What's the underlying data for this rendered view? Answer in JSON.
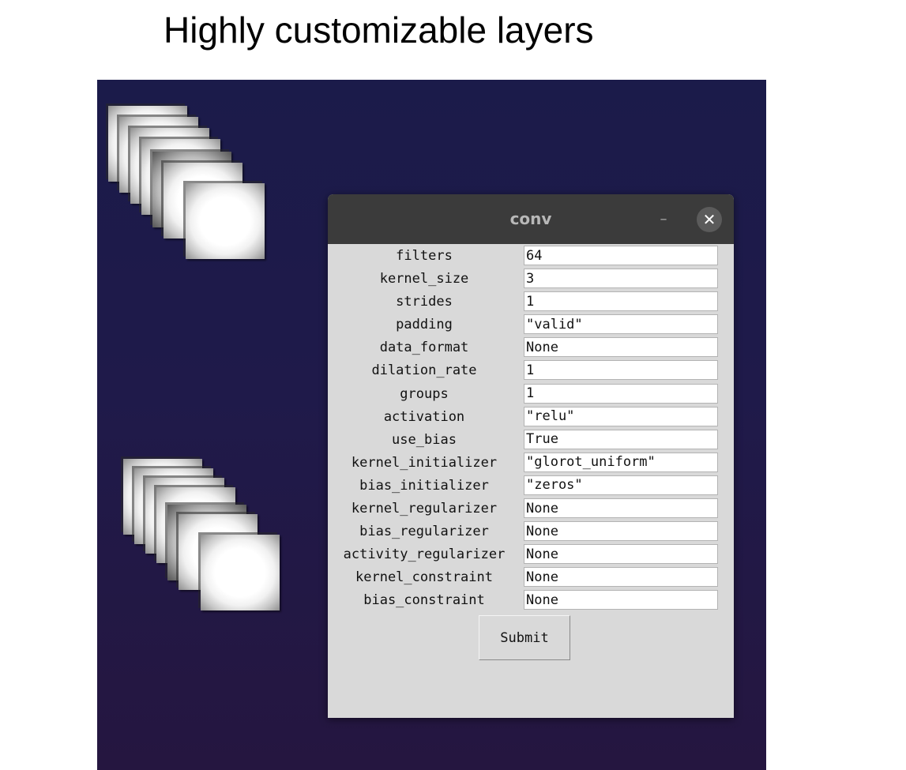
{
  "page": {
    "title": "Highly customizable layers"
  },
  "dialog": {
    "title": "conv",
    "minimize_glyph": "–",
    "close_glyph": "✕",
    "fields": [
      {
        "label": "filters",
        "value": "64"
      },
      {
        "label": "kernel_size",
        "value": "3"
      },
      {
        "label": "strides",
        "value": "1"
      },
      {
        "label": "padding",
        "value": "\"valid\""
      },
      {
        "label": "data_format",
        "value": "None"
      },
      {
        "label": "dilation_rate",
        "value": "1"
      },
      {
        "label": "groups",
        "value": "1"
      },
      {
        "label": "activation",
        "value": "\"relu\""
      },
      {
        "label": "use_bias",
        "value": "True"
      },
      {
        "label": "kernel_initializer",
        "value": "\"glorot_uniform\""
      },
      {
        "label": "bias_initializer",
        "value": "\"zeros\""
      },
      {
        "label": "kernel_regularizer",
        "value": "None"
      },
      {
        "label": "bias_regularizer",
        "value": "None"
      },
      {
        "label": "activity_regularizer",
        "value": "None"
      },
      {
        "label": "kernel_constraint",
        "value": "None"
      },
      {
        "label": "bias_constraint",
        "value": "None"
      }
    ],
    "submit_label": "Submit"
  },
  "canvas": {
    "layer_nodes": [
      "conv-layer-node-top",
      "conv-layer-node-bottom"
    ]
  },
  "colors": {
    "canvas_top": "#1b1b4a",
    "canvas_bottom": "#251640",
    "titlebar": "#3b3b3b",
    "dialog_bg": "#d9d9d9"
  },
  "icons": {
    "minimize": "minimize-icon",
    "close": "close-icon"
  }
}
